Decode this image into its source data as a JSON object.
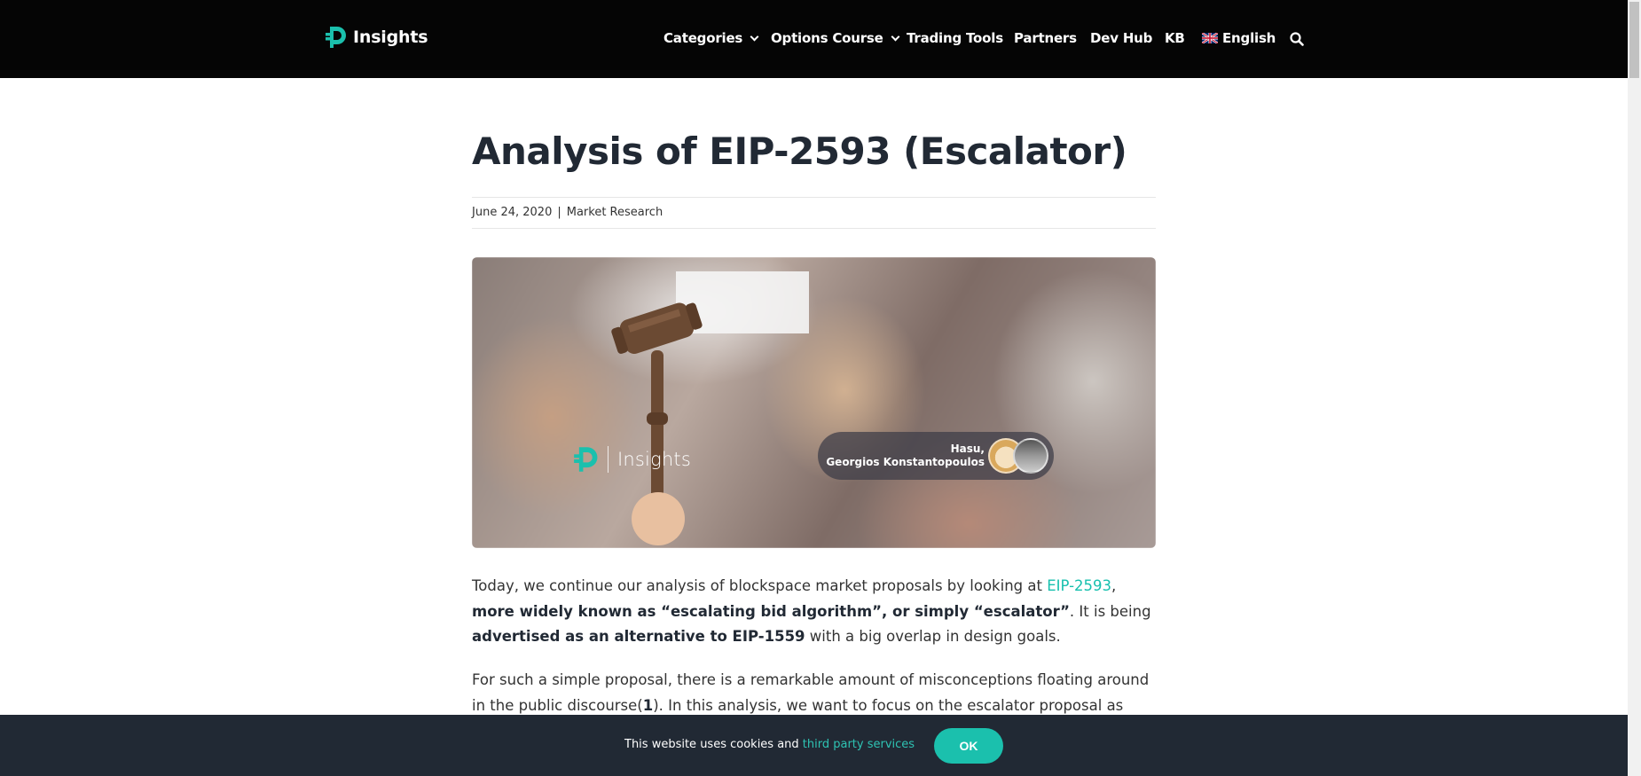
{
  "header": {
    "logo_text": "Insights",
    "nav": [
      {
        "label": "Categories",
        "has_dropdown": true
      },
      {
        "label": "Options Course",
        "has_dropdown": true
      },
      {
        "label": "Trading Tools",
        "has_dropdown": false
      },
      {
        "label": "Partners",
        "has_dropdown": false
      },
      {
        "label": "Dev Hub",
        "has_dropdown": false
      },
      {
        "label": "KB",
        "has_dropdown": false
      },
      {
        "label": "English",
        "has_dropdown": false,
        "icon": "uk-flag-icon"
      }
    ],
    "search_icon": "search-icon"
  },
  "article": {
    "title": "Analysis of EIP-2593 (Escalator)",
    "date": "June 24, 2020",
    "meta_separator": "|",
    "category": "Market Research",
    "hero": {
      "logo_text": "Insights",
      "authors_line1": "Hasu,",
      "authors_line2": "Georgios Konstantopoulos"
    },
    "para1": {
      "t1": "Today, we continue our analysis of blockspace market proposals by looking at ",
      "link": "EIP-2593",
      "t2": ", ",
      "b1": "more widely known as “escalating bid algorithm”, or simply “escalator”",
      "t3": ". It is being ",
      "b2": "advertised as an alternative to EIP-1559",
      "t4": " with a big overlap in design goals."
    },
    "para2": {
      "t1": "For such a simple proposal, there is a remarkable amount of misconceptions floating around in the public discourse(",
      "b1": "1",
      "t2": "). In this analysis, we want to focus on the escalator proposal as specified"
    }
  },
  "cookie_bar": {
    "text": "This website uses cookies and ",
    "link": "third party services",
    "button": "OK"
  },
  "colors": {
    "header_bg": "#050505",
    "accent": "#1bc0ad",
    "cookie_bg": "#212934",
    "title": "#212934"
  }
}
